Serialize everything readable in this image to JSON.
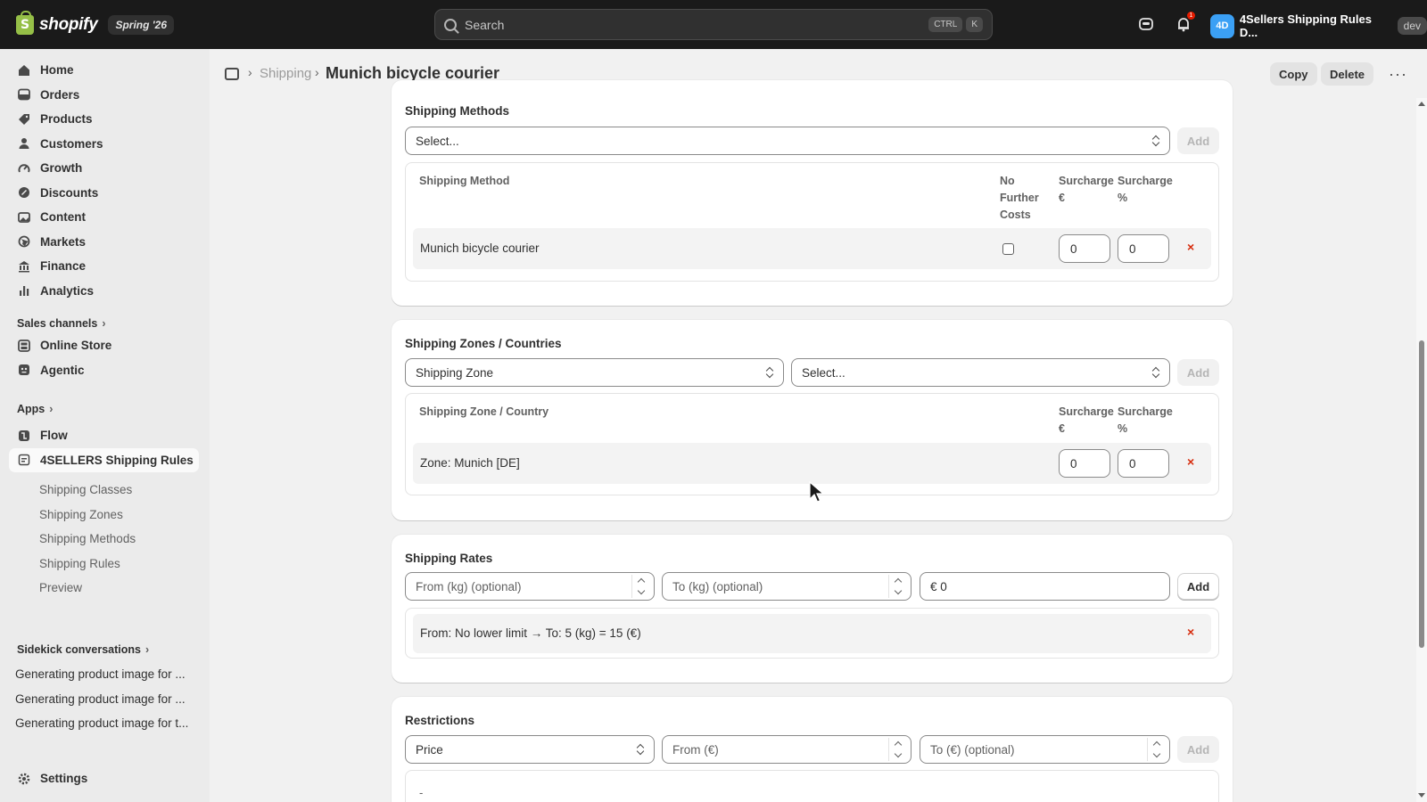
{
  "topbar": {
    "brand": "shopify",
    "version_badge": "Spring '26",
    "search_placeholder": "Search",
    "search_shortcut_ctrl": "CTRL",
    "search_shortcut_key": "K",
    "notification_count": "1",
    "store_initials": "4D",
    "store_name": "4Sellers Shipping Rules D...",
    "env_badge": "dev"
  },
  "sidebar": {
    "main_items": [
      {
        "label": "Home",
        "icon": "home-icon"
      },
      {
        "label": "Orders",
        "icon": "inbox-icon"
      },
      {
        "label": "Products",
        "icon": "tag-icon"
      },
      {
        "label": "Customers",
        "icon": "person-icon"
      },
      {
        "label": "Growth",
        "icon": "gauge-icon"
      },
      {
        "label": "Discounts",
        "icon": "discount-icon"
      },
      {
        "label": "Content",
        "icon": "image-icon"
      },
      {
        "label": "Markets",
        "icon": "globe-icon"
      },
      {
        "label": "Finance",
        "icon": "bank-icon"
      },
      {
        "label": "Analytics",
        "icon": "bar-chart-icon"
      }
    ],
    "sales_channels_heading": "Sales channels",
    "sales_channels": [
      {
        "label": "Online Store",
        "icon": "store-icon"
      },
      {
        "label": "Agentic",
        "icon": "agent-icon"
      }
    ],
    "apps_heading": "Apps",
    "apps": [
      {
        "label": "Flow",
        "icon": "flow-icon"
      },
      {
        "label": "4SELLERS Shipping Rules",
        "icon": "app-icon"
      }
    ],
    "app_subitems": [
      "Shipping Classes",
      "Shipping Zones",
      "Shipping Methods",
      "Shipping Rules",
      "Preview"
    ],
    "sidekick_heading": "Sidekick conversations",
    "sidekick_items": [
      "Generating product image for ...",
      "Generating product image for ...",
      "Generating product image for t..."
    ],
    "settings_label": "Settings"
  },
  "header": {
    "breadcrumb_parent": "Shipping",
    "title": "Munich bicycle courier",
    "copy_label": "Copy",
    "delete_label": "Delete",
    "more_label": "···"
  },
  "shipping_methods": {
    "title": "Shipping Methods",
    "select_placeholder": "Select...",
    "add_label": "Add",
    "columns": {
      "method": "Shipping Method",
      "no_further_costs": [
        "No",
        "Further",
        "Costs"
      ],
      "surcharge_eur": [
        "Surcharge",
        "€"
      ],
      "surcharge_pct": [
        "Surcharge",
        "%"
      ]
    },
    "rows": [
      {
        "name": "Munich bicycle courier",
        "no_further_costs": false,
        "surcharge_eur": "0",
        "surcharge_pct": "0"
      }
    ],
    "remove_label": "×"
  },
  "shipping_zones": {
    "title": "Shipping Zones / Countries",
    "type_select": "Shipping Zone",
    "select_placeholder": "Select...",
    "add_label": "Add",
    "columns": {
      "zone": "Shipping Zone / Country",
      "surcharge_eur": [
        "Surcharge",
        "€"
      ],
      "surcharge_pct": [
        "Surcharge",
        "%"
      ]
    },
    "rows": [
      {
        "name": "Zone: Munich [DE]",
        "surcharge_eur": "0",
        "surcharge_pct": "0"
      }
    ],
    "remove_label": "×"
  },
  "shipping_rates": {
    "title": "Shipping Rates",
    "from_placeholder": "From (kg) (optional)",
    "to_placeholder": "To (kg) (optional)",
    "price_value": "€ 0",
    "add_label": "Add",
    "rows": [
      "From: No lower limit → To: 5 (kg) = 15 (€)"
    ],
    "remove_label": "×"
  },
  "restrictions": {
    "title": "Restrictions",
    "type_select": "Price",
    "from_placeholder": "From (€)",
    "to_placeholder": "To (€) (optional)",
    "add_label": "Add",
    "empty_text": "-"
  },
  "colors": {
    "topbar_bg": "#1a1a1a",
    "remove_red": "#d72c0d",
    "avatar_blue": "#3ba0f5",
    "brand_green": "#95bf47"
  }
}
